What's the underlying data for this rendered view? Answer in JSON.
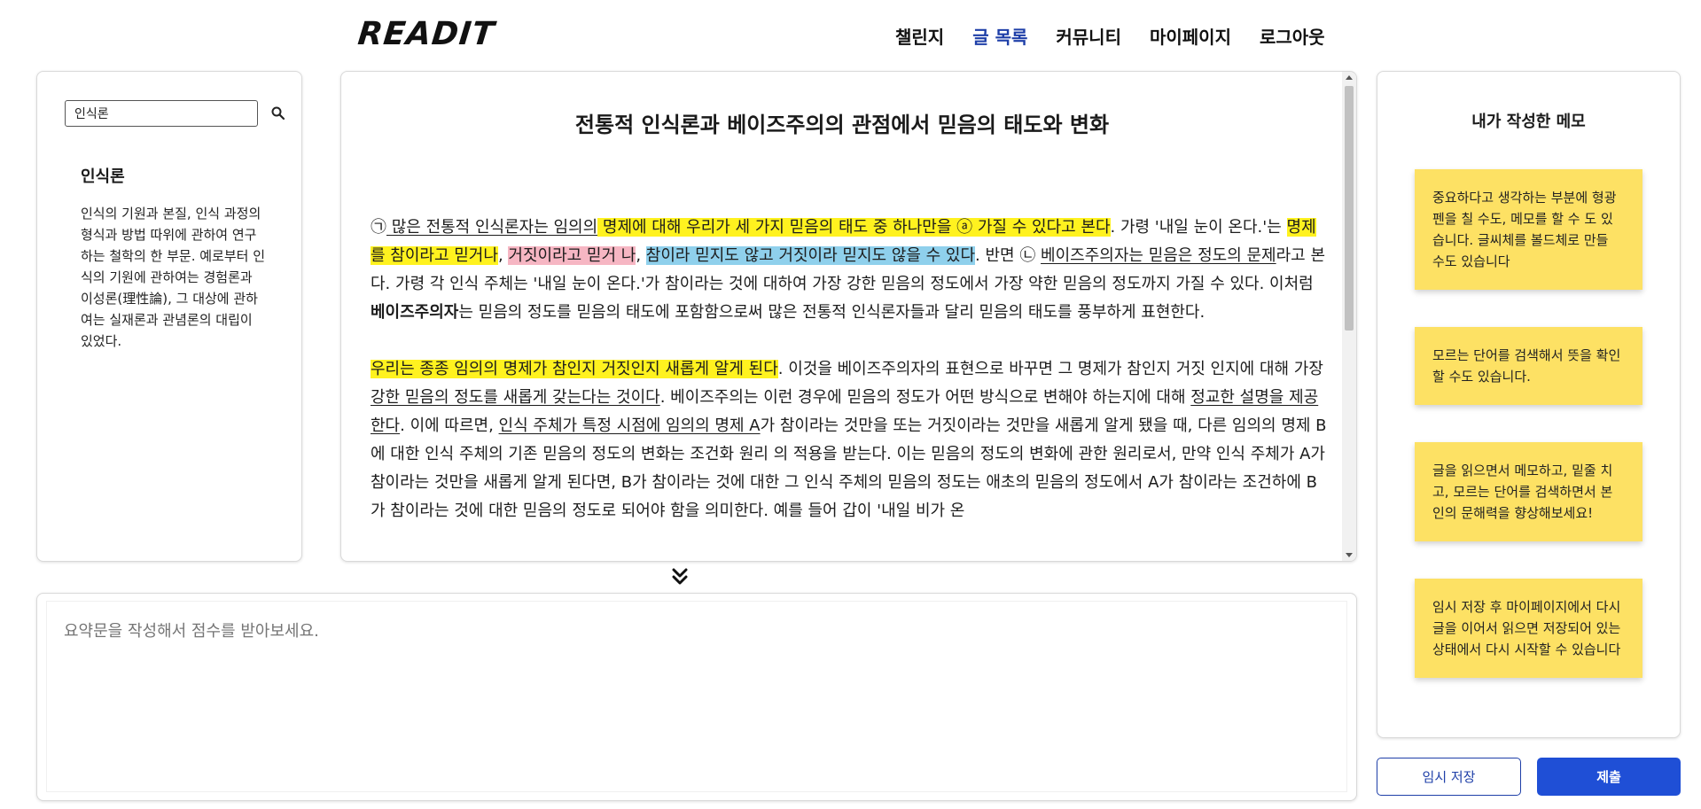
{
  "header": {
    "logo": "READIT",
    "nav": [
      "챌린지",
      "글 목록",
      "커뮤니티",
      "마이페이지",
      "로그아웃"
    ],
    "active_nav": "글 목록",
    "accent_color": "#1e3fa8"
  },
  "dictionary": {
    "search_value": "인식론",
    "search_icon": "search-icon",
    "word": "인식론",
    "definition": "인식의 기원과 본질, 인식 과정의 형식과 방법 따위에 관하여 연구하는 철학의 한 부문. 예로부터 인식의 기원에 관하여는 경험론과 이성론(理性論), 그 대상에 관하여는 실재론과 관념론의 대립이 있었다."
  },
  "article": {
    "title": "전통적 인식론과 베이즈주의의 관점에서 믿음의 태도와 변화",
    "highlight_colors": {
      "yellow": "#fff21f",
      "pink": "#f6b6c3",
      "blue": "#8fd0ec"
    },
    "p1": {
      "s1": "㉠",
      "s2": " 많은 전통적 인식론자는 임의의",
      "s3": " 명제에 대해 우리가 세 가지 믿음의 태도 중 하나만을 ⓐ 가질 수 있다고 본다",
      "s4": ". 가령 '내일 눈이 온다.'는 ",
      "s5": "명제를 참이라고 믿거나",
      "s6": ", ",
      "s7": "거짓이라고 믿거 나",
      "s8": ", ",
      "s9": "참이라 믿지도 않고 거짓이라 믿지도 않을 수 있다",
      "s10": ". 반면 ㉡ ",
      "s11": "베이즈주의자는 믿음은 정도의 문제",
      "s12": "라고 본다. 가령 각 인식 주체는 '내일 눈이 온다.'가 참이라는 것에 대하여 가장 강한 믿음의 정도에서 가장 약한 믿음의 정도까지 가질 수 있다. 이처럼 ",
      "s13": "베이즈주의자",
      "s14": "는 믿음의 정도를 믿음의 태도에 포함함으로써 많은 전통적 인식론자들과 달리 믿음의 태도를 풍부하게 표현한다."
    },
    "p2": {
      "s1": " 우리는 종종 임의의 명제가 참인지 거짓인지 새롭게 알게 된다",
      "s2": ". 이것을 베이즈주의자의 표현으로 바꾸면 그 명제가 참인지 거짓 인지에 대해 가장 ",
      "s3": "강한 믿음의 정도를 새롭게 갖는다는 것이다",
      "s4": ". 베이즈주의는 이런 경우에 믿음의 정도가 어떤 방식으로 변해야 하는지에 대해 ",
      "s5": "정교한 설명을 제공한다",
      "s6": ". 이에 따르면, ",
      "s7": "인식 주체가 특정 시점에 임의의 명제 A",
      "s8": "가 참이라는 것만을 또는 거짓이라는 것만을 새롭게 알게 됐을 때, 다른 임의의 명제 B에 대한 인식 주체의 기존 믿음의 정도의 변화는 조건화 원리 의 적용을 받는다. 이는 믿음의 정도의 변화에 관한 원리로서, 만약 인식 주체가 A가 참이라는 것만을 새롭게 알게 된다면, B가 참이라는 것에 대한 그 인식 주체의 믿음의 정도는 애초의 믿음의 정도에서 A가 참이라는 조건하에 B가 참이라는 것에 대한 믿음의 정도로 되어야 함을 의미한다. 예를 들어 갑이 '내일 비가 온"
    }
  },
  "expand_icon": "double-chevron-down-icon",
  "memos": {
    "title": "내가 작성한 메모",
    "items": [
      "중요하다고 생각하는 부분에 형광펜을 칠 수도, 메모를 할 수 도 있습니다. 글씨체를 볼드체로 만들 수도 있습니다",
      "모르는 단어를 검색해서 뜻을 확인할 수도 있습니다.",
      "글을 읽으면서 메모하고, 밑줄 치고, 모르는 단어를 검색하면서 본인의 문해력을 향상해보세요!",
      "임시 저장 후 마이페이지에서 다시 글을 이어서 읽으면 저장되어 있는 상태에서 다시 시작할 수 있습니다"
    ],
    "memo_color": "#fde164"
  },
  "summary": {
    "placeholder": "요약문을 작성해서 점수를 받아보세요."
  },
  "buttons": {
    "save": "임시 저장",
    "submit": "제출",
    "submit_color": "#1f4fd6"
  }
}
